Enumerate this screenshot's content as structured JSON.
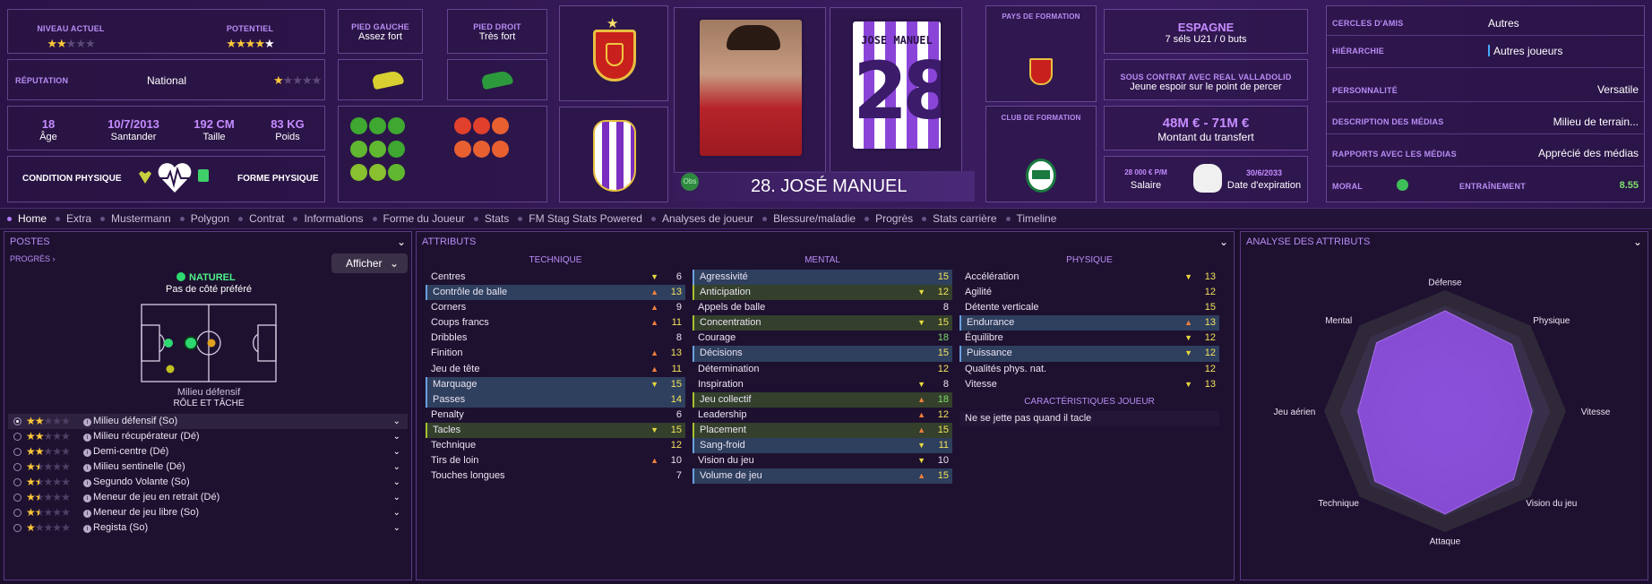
{
  "colors": {
    "accent": "#b98cf5",
    "star": "#ffc93a",
    "bg": "#1c0f2e"
  },
  "header": {
    "niveau_label": "NIVEAU ACTUEL",
    "potentiel_label": "POTENTIEL",
    "niveau_stars": 2,
    "potentiel_stars": 4,
    "reputation_label": "RÉPUTATION",
    "reputation_value": "National",
    "reputation_stars": 1,
    "age_value": "18",
    "age_label": "Âge",
    "birth_value": "10/7/2013",
    "birth_label": "Santander",
    "height_value": "192 CM",
    "height_label": "Taille",
    "weight_value": "83 KG",
    "weight_label": "Poids",
    "condition_label": "CONDITION PHYSIQUE",
    "forme_label": "FORME PHYSIQUE",
    "pied_gauche_label": "PIED GAUCHE",
    "pied_gauche_value": "Assez fort",
    "pied_droit_label": "PIED DROIT",
    "pied_droit_value": "Très fort",
    "player_name": "28. JOSÉ MANUEL",
    "obs_label": "Obs",
    "kit_name": "JOSE MANUEL",
    "kit_number": "28",
    "pays_formation_label": "PAYS DE FORMATION",
    "club_formation_label": "CLUB DE FORMATION",
    "nation_name": "ESPAGNE",
    "nation_caps": "7 séls U21 / 0 buts",
    "contract_label": "SOUS CONTRAT AVEC REAL VALLADOLID",
    "contract_value": "Jeune espoir sur le point de percer",
    "transfer_value": "48M € - 71M €",
    "transfer_label": "Montant du transfert",
    "salary_value": "28 000 € P/M",
    "salary_label": "Salaire",
    "expiry_value": "30/6/2033",
    "expiry_label": "Date d'expiration",
    "cercles_label": "CERCLES D'AMIS",
    "cercles_value": "Autres",
    "hierarchie_label": "HIÉRARCHIE",
    "hierarchie_value": "Autres joueurs",
    "personnalite_label": "PERSONNALITÉ",
    "personnalite_value": "Versatile",
    "desc_medias_label": "DESCRIPTION DES MÉDIAS",
    "desc_medias_value": "Milieu de terrain...",
    "rapports_label": "RAPPORTS AVEC LES MÉDIAS",
    "rapports_value": "Apprécié des médias",
    "moral_label": "MORAL",
    "entrainement_label": "ENTRAÎNEMENT",
    "entrainement_value": "8.55"
  },
  "tabs": [
    "Home",
    "Extra",
    "Mustermann",
    "Polygon",
    "Contrat",
    "Informations",
    "Forme du Joueur",
    "Stats",
    "FM Stag Stats Powered",
    "Analyses de joueur",
    "Blessure/maladie",
    "Progrès",
    "Stats carrière",
    "Timeline"
  ],
  "postes": {
    "title": "POSTES",
    "progres": "PROGRÈS",
    "afficher": "Afficher",
    "naturel": "NATUREL",
    "cote": "Pas de côté préféré",
    "role_pos": "Milieu défensif",
    "role_title": "RÔLE ET TÂCHE",
    "roles": [
      {
        "name": "Milieu défensif (So)",
        "stars": 2
      },
      {
        "name": "Milieu récupérateur (Dé)",
        "stars": 2
      },
      {
        "name": "Demi-centre (Dé)",
        "stars": 2
      },
      {
        "name": "Milieu sentinelle (Dé)",
        "stars": 1.5
      },
      {
        "name": "Segundo Volante (So)",
        "stars": 1.5
      },
      {
        "name": "Meneur de jeu en retrait (Dé)",
        "stars": 1.5
      },
      {
        "name": "Meneur de jeu libre (So)",
        "stars": 1.5
      },
      {
        "name": "Regista (So)",
        "stars": 1
      }
    ]
  },
  "attributs": {
    "title": "ATTRIBUTS",
    "technique_title": "TECHNIQUE",
    "mental_title": "MENTAL",
    "physique_title": "PHYSIQUE",
    "caract_title": "CARACTÉRISTIQUES JOUEUR",
    "caract_value": "Ne se jette pas quand il tacle",
    "technique": [
      {
        "name": "Centres",
        "value": 6,
        "arrow": "dn",
        "hl": ""
      },
      {
        "name": "Contrôle de balle",
        "value": 13,
        "arrow": "up",
        "hl": "hl"
      },
      {
        "name": "Corners",
        "value": 9,
        "arrow": "up",
        "hl": ""
      },
      {
        "name": "Coups francs",
        "value": 11,
        "arrow": "up",
        "hl": ""
      },
      {
        "name": "Dribbles",
        "value": 8,
        "arrow": "",
        "hl": ""
      },
      {
        "name": "Finition",
        "value": 13,
        "arrow": "up",
        "hl": ""
      },
      {
        "name": "Jeu de tête",
        "value": 11,
        "arrow": "up",
        "hl": ""
      },
      {
        "name": "Marquage",
        "value": 15,
        "arrow": "dn",
        "hl": "hl"
      },
      {
        "name": "Passes",
        "value": 14,
        "arrow": "",
        "hl": "hl"
      },
      {
        "name": "Penalty",
        "value": 6,
        "arrow": "",
        "hl": ""
      },
      {
        "name": "Tacles",
        "value": 15,
        "arrow": "dn",
        "hl": "hl2"
      },
      {
        "name": "Technique",
        "value": 12,
        "arrow": "",
        "hl": ""
      },
      {
        "name": "Tirs de loin",
        "value": 10,
        "arrow": "up",
        "hl": ""
      },
      {
        "name": "Touches longues",
        "value": 7,
        "arrow": "",
        "hl": ""
      }
    ],
    "mental": [
      {
        "name": "Agressivité",
        "value": 15,
        "arrow": "",
        "hl": "hl"
      },
      {
        "name": "Anticipation",
        "value": 12,
        "arrow": "dn",
        "hl": "hl2"
      },
      {
        "name": "Appels de balle",
        "value": 8,
        "arrow": "",
        "hl": ""
      },
      {
        "name": "Concentration",
        "value": 15,
        "arrow": "dn",
        "hl": "hl2"
      },
      {
        "name": "Courage",
        "value": 18,
        "arrow": "",
        "hl": ""
      },
      {
        "name": "Décisions",
        "value": 15,
        "arrow": "",
        "hl": "hl"
      },
      {
        "name": "Détermination",
        "value": 12,
        "arrow": "",
        "hl": ""
      },
      {
        "name": "Inspiration",
        "value": 8,
        "arrow": "dn",
        "hl": ""
      },
      {
        "name": "Jeu collectif",
        "value": 18,
        "arrow": "up",
        "hl": "hl2"
      },
      {
        "name": "Leadership",
        "value": 12,
        "arrow": "up",
        "hl": ""
      },
      {
        "name": "Placement",
        "value": 15,
        "arrow": "up",
        "hl": "hl2"
      },
      {
        "name": "Sang-froid",
        "value": 11,
        "arrow": "dn",
        "hl": "hl"
      },
      {
        "name": "Vision du jeu",
        "value": 10,
        "arrow": "dn",
        "hl": ""
      },
      {
        "name": "Volume de jeu",
        "value": 15,
        "arrow": "up",
        "hl": "hl"
      }
    ],
    "physique": [
      {
        "name": "Accélération",
        "value": 13,
        "arrow": "dn",
        "hl": ""
      },
      {
        "name": "Agilité",
        "value": 12,
        "arrow": "",
        "hl": ""
      },
      {
        "name": "Détente verticale",
        "value": 15,
        "arrow": "",
        "hl": ""
      },
      {
        "name": "Endurance",
        "value": 13,
        "arrow": "up",
        "hl": "hl"
      },
      {
        "name": "Équilibre",
        "value": 12,
        "arrow": "dn",
        "hl": ""
      },
      {
        "name": "Puissance",
        "value": 12,
        "arrow": "dn",
        "hl": "hl"
      },
      {
        "name": "Qualités phys. nat.",
        "value": 12,
        "arrow": "",
        "hl": ""
      },
      {
        "name": "Vitesse",
        "value": 13,
        "arrow": "dn",
        "hl": ""
      }
    ]
  },
  "analyse": {
    "title": "ANALYSE DES ATTRIBUTS",
    "axes": [
      "Défense",
      "Physique",
      "Vitesse",
      "Vision du jeu",
      "Attaque",
      "Technique",
      "Jeu aérien",
      "Mental"
    ]
  }
}
